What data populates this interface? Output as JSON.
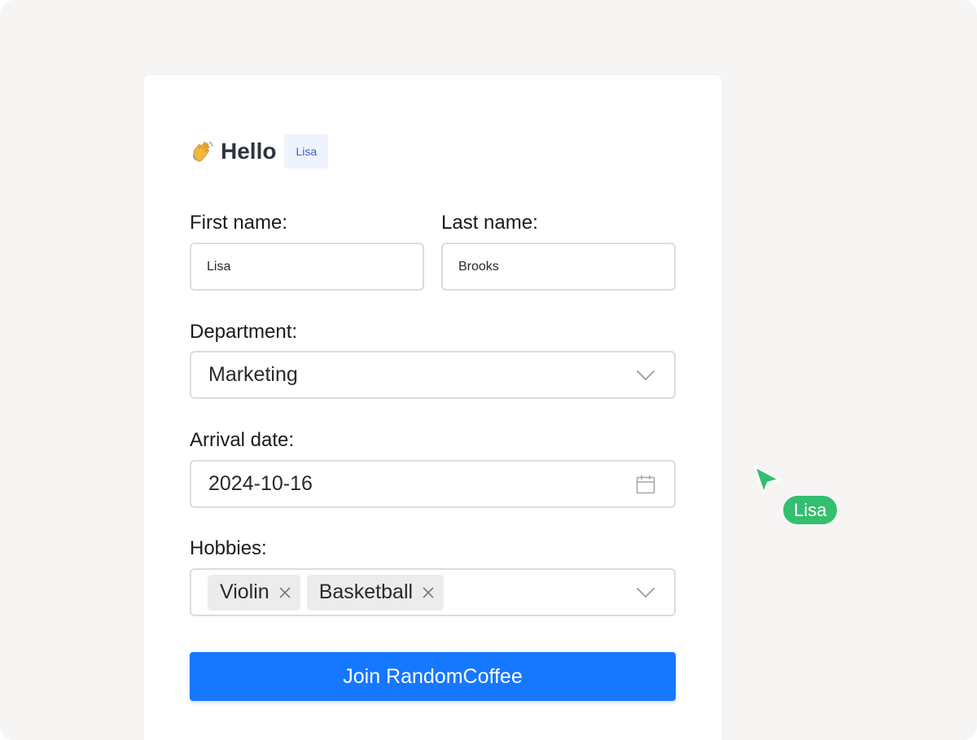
{
  "greeting": {
    "title": "Hello",
    "name_chip": "Lisa",
    "icon": "waving-hand-icon"
  },
  "form": {
    "first_name": {
      "label": "First name:",
      "value": "Lisa"
    },
    "last_name": {
      "label": "Last name:",
      "value": "Brooks"
    },
    "department": {
      "label": "Department:",
      "value": "Marketing",
      "icon": "chevron-down-icon"
    },
    "arrival_date": {
      "label": "Arrival date:",
      "value": "2024-10-16",
      "icon": "calendar-icon"
    },
    "hobbies": {
      "label": "Hobbies:",
      "tags": [
        {
          "label": "Violin"
        },
        {
          "label": "Basketball"
        }
      ],
      "icon": "chevron-down-icon"
    },
    "submit_label": "Join RandomCoffee"
  },
  "collab_cursor": {
    "user": "Lisa",
    "color": "#33bf6f"
  },
  "colors": {
    "primary": "#1677ff",
    "chip_bg": "#eef3fd",
    "chip_text": "#3a64c8"
  }
}
